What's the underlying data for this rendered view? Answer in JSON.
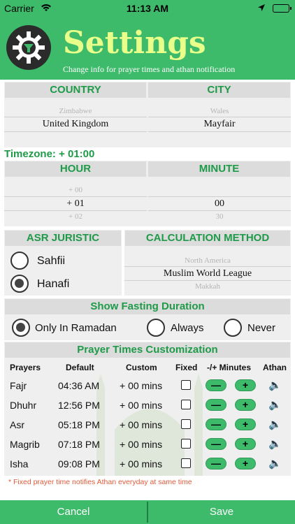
{
  "status_bar": {
    "carrier": "Carrier",
    "time": "11:13 AM"
  },
  "header": {
    "title": "Settings",
    "subtitle": "Change info for prayer times and athan notification"
  },
  "location": {
    "country_label": "COUNTRY",
    "city_label": "CITY",
    "country_prev": "Zimbabwe",
    "country_selected": "United Kingdom",
    "city_prev": "Wales",
    "city_selected": "Mayfair"
  },
  "timezone": {
    "text": "Timezone: + 01:00"
  },
  "time_offset": {
    "hour_label": "HOUR",
    "minute_label": "MINUTE",
    "hour_prev": "+ 00",
    "hour_selected": "+ 01",
    "hour_next": "+ 02",
    "minute_selected": "00",
    "minute_next": "30"
  },
  "asr": {
    "label": "ASR JURISTIC",
    "options": [
      "Sahfii",
      "Hanafi"
    ],
    "selected": "Hanafi"
  },
  "calculation": {
    "label": "CALCULATION METHOD",
    "prev": "North America",
    "selected": "Muslim World League",
    "next": "Makkah"
  },
  "fasting": {
    "label": "Show Fasting Duration",
    "options": [
      "Only In Ramadan",
      "Always",
      "Never"
    ],
    "selected": "Only In Ramadan"
  },
  "customization": {
    "label": "Prayer Times Customization",
    "columns": [
      "Prayers",
      "Default",
      "Custom",
      "Fixed",
      "-/+ Minutes",
      "Athan"
    ],
    "rows": [
      {
        "prayer": "Fajr",
        "default": "04:36 AM",
        "custom": "+ 00 mins"
      },
      {
        "prayer": "Dhuhr",
        "default": "12:56 PM",
        "custom": "+ 00 mins"
      },
      {
        "prayer": "Asr",
        "default": "05:18 PM",
        "custom": "+ 00 mins"
      },
      {
        "prayer": "Magrib",
        "default": "07:18 PM",
        "custom": "+ 00 mins"
      },
      {
        "prayer": "Isha",
        "default": "09:08 PM",
        "custom": "+ 00 mins"
      }
    ],
    "minus_symbol": "—",
    "plus_symbol": "+",
    "note": "* Fixed prayer time notifies Athan everyday at same time"
  },
  "footer": {
    "cancel": "Cancel",
    "save": "Save"
  },
  "colors": {
    "accent": "#3dbb6b",
    "title": "#e8ff8a",
    "label": "#1e9a48",
    "note": "#e05a3a"
  }
}
